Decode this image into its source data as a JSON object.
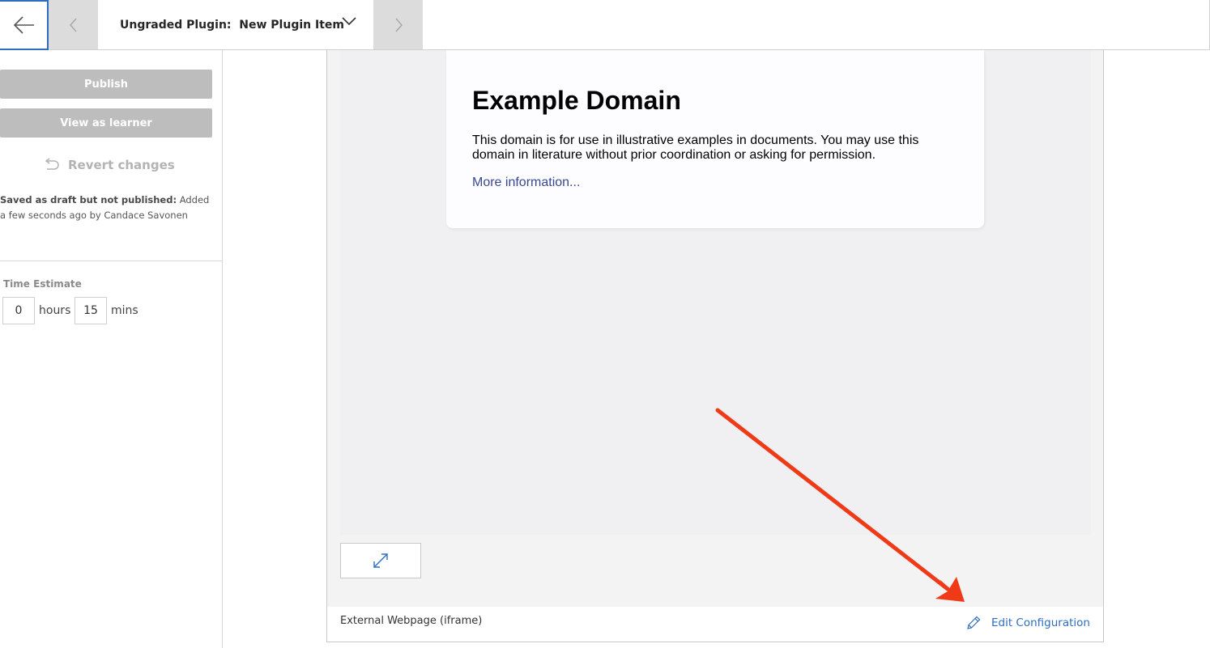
{
  "topbar": {
    "title": "Ungraded Plugin:  New Plugin Item",
    "back_icon": "arrow-left-icon",
    "prev_icon": "chevron-left-icon",
    "next_icon": "chevron-right-icon",
    "dropdown_icon": "chevron-down-icon"
  },
  "sidebar": {
    "publish_label": "Publish",
    "view_as_learner_label": "View as learner",
    "revert_label": "Revert changes",
    "revert_icon": "undo-icon",
    "draft_status_bold": "Saved as draft but not published:",
    "draft_status_text": " Added a few seconds ago by Candace Savonen",
    "time_estimate": {
      "label": "Time Estimate",
      "hours_value": "0",
      "hours_unit": "hours",
      "mins_value": "15",
      "mins_unit": "mins"
    }
  },
  "plugin": {
    "iframe": {
      "heading": "Example Domain",
      "paragraph": "This domain is for use in illustrative examples in documents. You may use this domain in literature without prior coordination or asking for permission.",
      "link_text": "More information..."
    },
    "expand_icon": "expand-icon",
    "footer_label": "External Webpage (iframe)",
    "edit_config_label": "Edit Configuration",
    "edit_icon": "pencil-icon"
  },
  "colors": {
    "accent_blue": "#2f6dc0",
    "disabled_button_gray": "#bdbdbd",
    "annotation_red": "#f03a17",
    "link_navy": "#38488f"
  }
}
